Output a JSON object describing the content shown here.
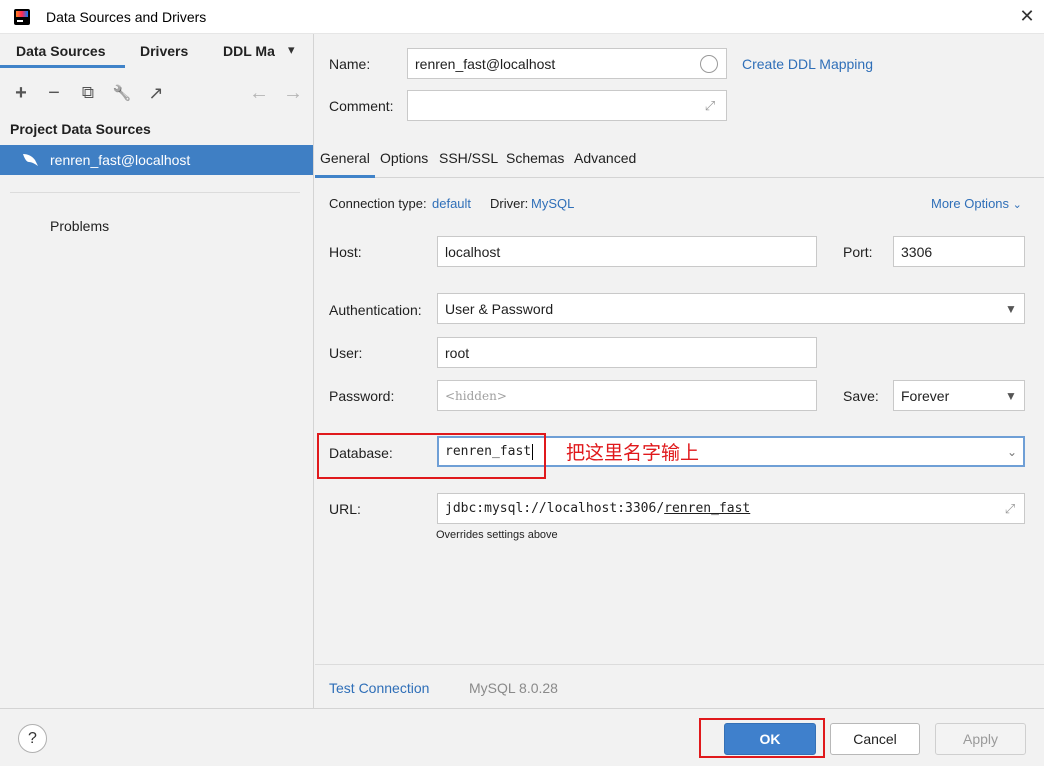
{
  "window": {
    "title": "Data Sources and Drivers",
    "close_glyph": "✕"
  },
  "sidebar": {
    "tabs": [
      {
        "label": "Data Sources",
        "active": true
      },
      {
        "label": "Drivers",
        "active": false
      },
      {
        "label": "DDL Ma",
        "active": false
      }
    ],
    "tabs_more_glyph": "▾",
    "toolbar": [
      {
        "name": "add-icon",
        "glyph": "+"
      },
      {
        "name": "remove-icon",
        "glyph": "−"
      },
      {
        "name": "duplicate-icon",
        "glyph": "⧉"
      },
      {
        "name": "wrench-icon",
        "glyph": "🔧"
      },
      {
        "name": "jump-to-icon",
        "glyph": "↗"
      },
      {
        "name": "back-arrow-icon",
        "glyph": "←"
      },
      {
        "name": "forward-arrow-icon",
        "glyph": "→"
      }
    ],
    "section_heading": "Project Data Sources",
    "data_sources": [
      {
        "label": "renren_fast@localhost",
        "icon": "mysql-dolphin-icon",
        "selected": true
      }
    ],
    "problems_label": "Problems"
  },
  "form": {
    "name_label": "Name:",
    "name_value": "renren_fast@localhost",
    "comment_label": "Comment:",
    "comment_value": "",
    "create_ddl_link": "Create DDL Mapping",
    "tabs": [
      "General",
      "Options",
      "SSH/SSL",
      "Schemas",
      "Advanced"
    ],
    "active_tab": "General",
    "connection_type_label": "Connection type:",
    "connection_type_value": "default",
    "driver_label": "Driver:",
    "driver_value": "MySQL",
    "more_options": "More Options",
    "host_label": "Host:",
    "host_value": "localhost",
    "port_label": "Port:",
    "port_value": "3306",
    "auth_label": "Authentication:",
    "auth_value": "User & Password",
    "user_label": "User:",
    "user_value": "root",
    "password_label": "Password:",
    "password_placeholder": "<hidden>",
    "save_label": "Save:",
    "save_value": "Forever",
    "database_label": "Database:",
    "database_value": "renren_fast",
    "url_label": "URL:",
    "url_prefix": "jdbc:mysql://localhost:3306/",
    "url_db": "renren_fast",
    "url_hint": "Overrides settings above",
    "test_connection": "Test Connection",
    "server_version": "MySQL 8.0.28"
  },
  "footer": {
    "help_glyph": "?",
    "ok": "OK",
    "cancel": "Cancel",
    "apply": "Apply"
  },
  "annotation": {
    "text": "把这里名字输上",
    "color": "#e0191c"
  },
  "colors": {
    "accent": "#3f80cc",
    "selection": "#3f7fc4",
    "link": "#2f6fb8"
  }
}
